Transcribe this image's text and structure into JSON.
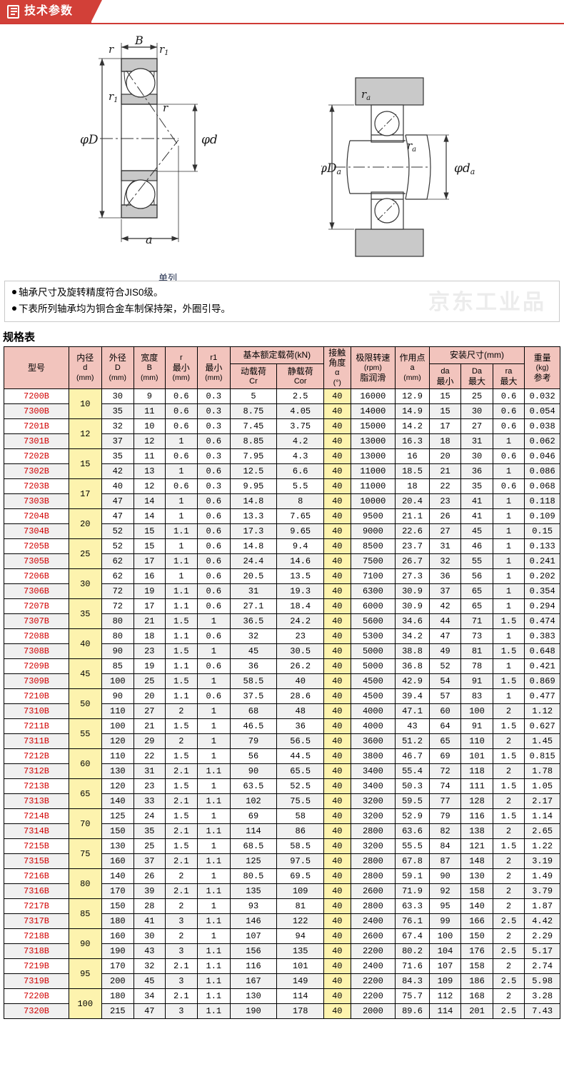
{
  "banner": {
    "title": "技术参数",
    "icon": "document-lines-icon"
  },
  "diagram": {
    "caption": "单列",
    "left_labels": [
      "B",
      "r",
      "r1",
      "r1",
      "r",
      "φD",
      "φd",
      "a"
    ],
    "right_labels": [
      "ra",
      "ra",
      "φDa",
      "φda"
    ]
  },
  "notes": {
    "watermark": "京东工业品",
    "items": [
      "轴承尺寸及旋转精度符合JIS0级。",
      "下表所列轴承均为铜合金车制保持架，外圈引导。"
    ]
  },
  "spec_title": "规格表",
  "table": {
    "headers": {
      "model": "型号",
      "bore": {
        "name": "内径",
        "sym": "d",
        "unit": "(mm)"
      },
      "outer": {
        "name": "外径",
        "sym": "D",
        "unit": "(mm)"
      },
      "width": {
        "name": "宽度",
        "sym": "B",
        "unit": "(mm)"
      },
      "r": {
        "sym": "r",
        "name": "最小",
        "unit": "(mm)"
      },
      "r1": {
        "sym": "r1",
        "name": "最小",
        "unit": "(mm)"
      },
      "load_group": "基本额定载荷(kN)",
      "cr": {
        "name": "动载荷",
        "sym": "Cr"
      },
      "cor": {
        "name": "静载荷",
        "sym": "Cor"
      },
      "angle": {
        "l1": "接触",
        "l2": "角度",
        "l3": "α",
        "l4": "(°)"
      },
      "speed": {
        "l1": "极限转速",
        "l2": "(rpm)",
        "l3": "脂润滑"
      },
      "point": {
        "l1": "作用点",
        "l2": "a",
        "l3": "(mm)"
      },
      "mount_group": "安装尺寸(mm)",
      "da": {
        "sym": "da",
        "name": "最小"
      },
      "Da": {
        "sym": "Da",
        "name": "最大"
      },
      "ra": {
        "sym": "ra",
        "name": "最大"
      },
      "weight": {
        "l1": "重量",
        "l2": "(kg)",
        "l3": "参考"
      }
    },
    "rows": [
      {
        "model": "7200B",
        "bore": "10",
        "bore_span": 2,
        "D": "30",
        "B": "9",
        "r": "0.6",
        "r1": "0.3",
        "cr": "5",
        "cor": "2.5",
        "angle": "40",
        "speed": "16000",
        "a": "12.9",
        "da": "15",
        "Da": "25",
        "ra": "0.6",
        "w": "0.032"
      },
      {
        "model": "7300B",
        "bore": null,
        "D": "35",
        "B": "11",
        "r": "0.6",
        "r1": "0.3",
        "cr": "8.75",
        "cor": "4.05",
        "angle": "40",
        "speed": "14000",
        "a": "14.9",
        "da": "15",
        "Da": "30",
        "ra": "0.6",
        "w": "0.054"
      },
      {
        "model": "7201B",
        "bore": "12",
        "bore_span": 2,
        "D": "32",
        "B": "10",
        "r": "0.6",
        "r1": "0.3",
        "cr": "7.45",
        "cor": "3.75",
        "angle": "40",
        "speed": "15000",
        "a": "14.2",
        "da": "17",
        "Da": "27",
        "ra": "0.6",
        "w": "0.038"
      },
      {
        "model": "7301B",
        "bore": null,
        "D": "37",
        "B": "12",
        "r": "1",
        "r1": "0.6",
        "cr": "8.85",
        "cor": "4.2",
        "angle": "40",
        "speed": "13000",
        "a": "16.3",
        "da": "18",
        "Da": "31",
        "ra": "1",
        "w": "0.062"
      },
      {
        "model": "7202B",
        "bore": "15",
        "bore_span": 2,
        "D": "35",
        "B": "11",
        "r": "0.6",
        "r1": "0.3",
        "cr": "7.95",
        "cor": "4.3",
        "angle": "40",
        "speed": "13000",
        "a": "16",
        "da": "20",
        "Da": "30",
        "ra": "0.6",
        "w": "0.046"
      },
      {
        "model": "7302B",
        "bore": null,
        "D": "42",
        "B": "13",
        "r": "1",
        "r1": "0.6",
        "cr": "12.5",
        "cor": "6.6",
        "angle": "40",
        "speed": "11000",
        "a": "18.5",
        "da": "21",
        "Da": "36",
        "ra": "1",
        "w": "0.086"
      },
      {
        "model": "7203B",
        "bore": "17",
        "bore_span": 2,
        "D": "40",
        "B": "12",
        "r": "0.6",
        "r1": "0.3",
        "cr": "9.95",
        "cor": "5.5",
        "angle": "40",
        "speed": "11000",
        "a": "18",
        "da": "22",
        "Da": "35",
        "ra": "0.6",
        "w": "0.068"
      },
      {
        "model": "7303B",
        "bore": null,
        "D": "47",
        "B": "14",
        "r": "1",
        "r1": "0.6",
        "cr": "14.8",
        "cor": "8",
        "angle": "40",
        "speed": "10000",
        "a": "20.4",
        "da": "23",
        "Da": "41",
        "ra": "1",
        "w": "0.118"
      },
      {
        "model": "7204B",
        "bore": "20",
        "bore_span": 2,
        "D": "47",
        "B": "14",
        "r": "1",
        "r1": "0.6",
        "cr": "13.3",
        "cor": "7.65",
        "angle": "40",
        "speed": "9500",
        "a": "21.1",
        "da": "26",
        "Da": "41",
        "ra": "1",
        "w": "0.109"
      },
      {
        "model": "7304B",
        "bore": null,
        "D": "52",
        "B": "15",
        "r": "1.1",
        "r1": "0.6",
        "cr": "17.3",
        "cor": "9.65",
        "angle": "40",
        "speed": "9000",
        "a": "22.6",
        "da": "27",
        "Da": "45",
        "ra": "1",
        "w": "0.15"
      },
      {
        "model": "7205B",
        "bore": "25",
        "bore_span": 2,
        "D": "52",
        "B": "15",
        "r": "1",
        "r1": "0.6",
        "cr": "14.8",
        "cor": "9.4",
        "angle": "40",
        "speed": "8500",
        "a": "23.7",
        "da": "31",
        "Da": "46",
        "ra": "1",
        "w": "0.133"
      },
      {
        "model": "7305B",
        "bore": null,
        "D": "62",
        "B": "17",
        "r": "1.1",
        "r1": "0.6",
        "cr": "24.4",
        "cor": "14.6",
        "angle": "40",
        "speed": "7500",
        "a": "26.7",
        "da": "32",
        "Da": "55",
        "ra": "1",
        "w": "0.241"
      },
      {
        "model": "7206B",
        "bore": "30",
        "bore_span": 2,
        "D": "62",
        "B": "16",
        "r": "1",
        "r1": "0.6",
        "cr": "20.5",
        "cor": "13.5",
        "angle": "40",
        "speed": "7100",
        "a": "27.3",
        "da": "36",
        "Da": "56",
        "ra": "1",
        "w": "0.202"
      },
      {
        "model": "7306B",
        "bore": null,
        "D": "72",
        "B": "19",
        "r": "1.1",
        "r1": "0.6",
        "cr": "31",
        "cor": "19.3",
        "angle": "40",
        "speed": "6300",
        "a": "30.9",
        "da": "37",
        "Da": "65",
        "ra": "1",
        "w": "0.354"
      },
      {
        "model": "7207B",
        "bore": "35",
        "bore_span": 2,
        "D": "72",
        "B": "17",
        "r": "1.1",
        "r1": "0.6",
        "cr": "27.1",
        "cor": "18.4",
        "angle": "40",
        "speed": "6000",
        "a": "30.9",
        "da": "42",
        "Da": "65",
        "ra": "1",
        "w": "0.294"
      },
      {
        "model": "7307B",
        "bore": null,
        "D": "80",
        "B": "21",
        "r": "1.5",
        "r1": "1",
        "cr": "36.5",
        "cor": "24.2",
        "angle": "40",
        "speed": "5600",
        "a": "34.6",
        "da": "44",
        "Da": "71",
        "ra": "1.5",
        "w": "0.474"
      },
      {
        "model": "7208B",
        "bore": "40",
        "bore_span": 2,
        "D": "80",
        "B": "18",
        "r": "1.1",
        "r1": "0.6",
        "cr": "32",
        "cor": "23",
        "angle": "40",
        "speed": "5300",
        "a": "34.2",
        "da": "47",
        "Da": "73",
        "ra": "1",
        "w": "0.383"
      },
      {
        "model": "7308B",
        "bore": null,
        "D": "90",
        "B": "23",
        "r": "1.5",
        "r1": "1",
        "cr": "45",
        "cor": "30.5",
        "angle": "40",
        "speed": "5000",
        "a": "38.8",
        "da": "49",
        "Da": "81",
        "ra": "1.5",
        "w": "0.648"
      },
      {
        "model": "7209B",
        "bore": "45",
        "bore_span": 2,
        "D": "85",
        "B": "19",
        "r": "1.1",
        "r1": "0.6",
        "cr": "36",
        "cor": "26.2",
        "angle": "40",
        "speed": "5000",
        "a": "36.8",
        "da": "52",
        "Da": "78",
        "ra": "1",
        "w": "0.421"
      },
      {
        "model": "7309B",
        "bore": null,
        "D": "100",
        "B": "25",
        "r": "1.5",
        "r1": "1",
        "cr": "58.5",
        "cor": "40",
        "angle": "40",
        "speed": "4500",
        "a": "42.9",
        "da": "54",
        "Da": "91",
        "ra": "1.5",
        "w": "0.869"
      },
      {
        "model": "7210B",
        "bore": "50",
        "bore_span": 2,
        "D": "90",
        "B": "20",
        "r": "1.1",
        "r1": "0.6",
        "cr": "37.5",
        "cor": "28.6",
        "angle": "40",
        "speed": "4500",
        "a": "39.4",
        "da": "57",
        "Da": "83",
        "ra": "1",
        "w": "0.477"
      },
      {
        "model": "7310B",
        "bore": null,
        "D": "110",
        "B": "27",
        "r": "2",
        "r1": "1",
        "cr": "68",
        "cor": "48",
        "angle": "40",
        "speed": "4000",
        "a": "47.1",
        "da": "60",
        "Da": "100",
        "ra": "2",
        "w": "1.12"
      },
      {
        "model": "7211B",
        "bore": "55",
        "bore_span": 2,
        "D": "100",
        "B": "21",
        "r": "1.5",
        "r1": "1",
        "cr": "46.5",
        "cor": "36",
        "angle": "40",
        "speed": "4000",
        "a": "43",
        "da": "64",
        "Da": "91",
        "ra": "1.5",
        "w": "0.627"
      },
      {
        "model": "7311B",
        "bore": null,
        "D": "120",
        "B": "29",
        "r": "2",
        "r1": "1",
        "cr": "79",
        "cor": "56.5",
        "angle": "40",
        "speed": "3600",
        "a": "51.2",
        "da": "65",
        "Da": "110",
        "ra": "2",
        "w": "1.45"
      },
      {
        "model": "7212B",
        "bore": "60",
        "bore_span": 2,
        "D": "110",
        "B": "22",
        "r": "1.5",
        "r1": "1",
        "cr": "56",
        "cor": "44.5",
        "angle": "40",
        "speed": "3800",
        "a": "46.7",
        "da": "69",
        "Da": "101",
        "ra": "1.5",
        "w": "0.815"
      },
      {
        "model": "7312B",
        "bore": null,
        "D": "130",
        "B": "31",
        "r": "2.1",
        "r1": "1.1",
        "cr": "90",
        "cor": "65.5",
        "angle": "40",
        "speed": "3400",
        "a": "55.4",
        "da": "72",
        "Da": "118",
        "ra": "2",
        "w": "1.78"
      },
      {
        "model": "7213B",
        "bore": "65",
        "bore_span": 2,
        "D": "120",
        "B": "23",
        "r": "1.5",
        "r1": "1",
        "cr": "63.5",
        "cor": "52.5",
        "angle": "40",
        "speed": "3400",
        "a": "50.3",
        "da": "74",
        "Da": "111",
        "ra": "1.5",
        "w": "1.05"
      },
      {
        "model": "7313B",
        "bore": null,
        "D": "140",
        "B": "33",
        "r": "2.1",
        "r1": "1.1",
        "cr": "102",
        "cor": "75.5",
        "angle": "40",
        "speed": "3200",
        "a": "59.5",
        "da": "77",
        "Da": "128",
        "ra": "2",
        "w": "2.17"
      },
      {
        "model": "7214B",
        "bore": "70",
        "bore_span": 2,
        "D": "125",
        "B": "24",
        "r": "1.5",
        "r1": "1",
        "cr": "69",
        "cor": "58",
        "angle": "40",
        "speed": "3200",
        "a": "52.9",
        "da": "79",
        "Da": "116",
        "ra": "1.5",
        "w": "1.14"
      },
      {
        "model": "7314B",
        "bore": null,
        "D": "150",
        "B": "35",
        "r": "2.1",
        "r1": "1.1",
        "cr": "114",
        "cor": "86",
        "angle": "40",
        "speed": "2800",
        "a": "63.6",
        "da": "82",
        "Da": "138",
        "ra": "2",
        "w": "2.65"
      },
      {
        "model": "7215B",
        "bore": "75",
        "bore_span": 2,
        "D": "130",
        "B": "25",
        "r": "1.5",
        "r1": "1",
        "cr": "68.5",
        "cor": "58.5",
        "angle": "40",
        "speed": "3200",
        "a": "55.5",
        "da": "84",
        "Da": "121",
        "ra": "1.5",
        "w": "1.22"
      },
      {
        "model": "7315B",
        "bore": null,
        "D": "160",
        "B": "37",
        "r": "2.1",
        "r1": "1.1",
        "cr": "125",
        "cor": "97.5",
        "angle": "40",
        "speed": "2800",
        "a": "67.8",
        "da": "87",
        "Da": "148",
        "ra": "2",
        "w": "3.19"
      },
      {
        "model": "7216B",
        "bore": "80",
        "bore_span": 2,
        "D": "140",
        "B": "26",
        "r": "2",
        "r1": "1",
        "cr": "80.5",
        "cor": "69.5",
        "angle": "40",
        "speed": "2800",
        "a": "59.1",
        "da": "90",
        "Da": "130",
        "ra": "2",
        "w": "1.49"
      },
      {
        "model": "7316B",
        "bore": null,
        "D": "170",
        "B": "39",
        "r": "2.1",
        "r1": "1.1",
        "cr": "135",
        "cor": "109",
        "angle": "40",
        "speed": "2600",
        "a": "71.9",
        "da": "92",
        "Da": "158",
        "ra": "2",
        "w": "3.79"
      },
      {
        "model": "7217B",
        "bore": "85",
        "bore_span": 2,
        "D": "150",
        "B": "28",
        "r": "2",
        "r1": "1",
        "cr": "93",
        "cor": "81",
        "angle": "40",
        "speed": "2800",
        "a": "63.3",
        "da": "95",
        "Da": "140",
        "ra": "2",
        "w": "1.87"
      },
      {
        "model": "7317B",
        "bore": null,
        "D": "180",
        "B": "41",
        "r": "3",
        "r1": "1.1",
        "cr": "146",
        "cor": "122",
        "angle": "40",
        "speed": "2400",
        "a": "76.1",
        "da": "99",
        "Da": "166",
        "ra": "2.5",
        "w": "4.42"
      },
      {
        "model": "7218B",
        "bore": "90",
        "bore_span": 2,
        "D": "160",
        "B": "30",
        "r": "2",
        "r1": "1",
        "cr": "107",
        "cor": "94",
        "angle": "40",
        "speed": "2600",
        "a": "67.4",
        "da": "100",
        "Da": "150",
        "ra": "2",
        "w": "2.29"
      },
      {
        "model": "7318B",
        "bore": null,
        "D": "190",
        "B": "43",
        "r": "3",
        "r1": "1.1",
        "cr": "156",
        "cor": "135",
        "angle": "40",
        "speed": "2200",
        "a": "80.2",
        "da": "104",
        "Da": "176",
        "ra": "2.5",
        "w": "5.17"
      },
      {
        "model": "7219B",
        "bore": "95",
        "bore_span": 2,
        "D": "170",
        "B": "32",
        "r": "2.1",
        "r1": "1.1",
        "cr": "116",
        "cor": "101",
        "angle": "40",
        "speed": "2400",
        "a": "71.6",
        "da": "107",
        "Da": "158",
        "ra": "2",
        "w": "2.74"
      },
      {
        "model": "7319B",
        "bore": null,
        "D": "200",
        "B": "45",
        "r": "3",
        "r1": "1.1",
        "cr": "167",
        "cor": "149",
        "angle": "40",
        "speed": "2200",
        "a": "84.3",
        "da": "109",
        "Da": "186",
        "ra": "2.5",
        "w": "5.98"
      },
      {
        "model": "7220B",
        "bore": "100",
        "bore_span": 2,
        "D": "180",
        "B": "34",
        "r": "2.1",
        "r1": "1.1",
        "cr": "130",
        "cor": "114",
        "angle": "40",
        "speed": "2200",
        "a": "75.7",
        "da": "112",
        "Da": "168",
        "ra": "2",
        "w": "3.28"
      },
      {
        "model": "7320B",
        "bore": null,
        "D": "215",
        "B": "47",
        "r": "3",
        "r1": "1.1",
        "cr": "190",
        "cor": "178",
        "angle": "40",
        "speed": "2000",
        "a": "89.6",
        "da": "114",
        "Da": "201",
        "ra": "2.5",
        "w": "7.43"
      }
    ]
  }
}
